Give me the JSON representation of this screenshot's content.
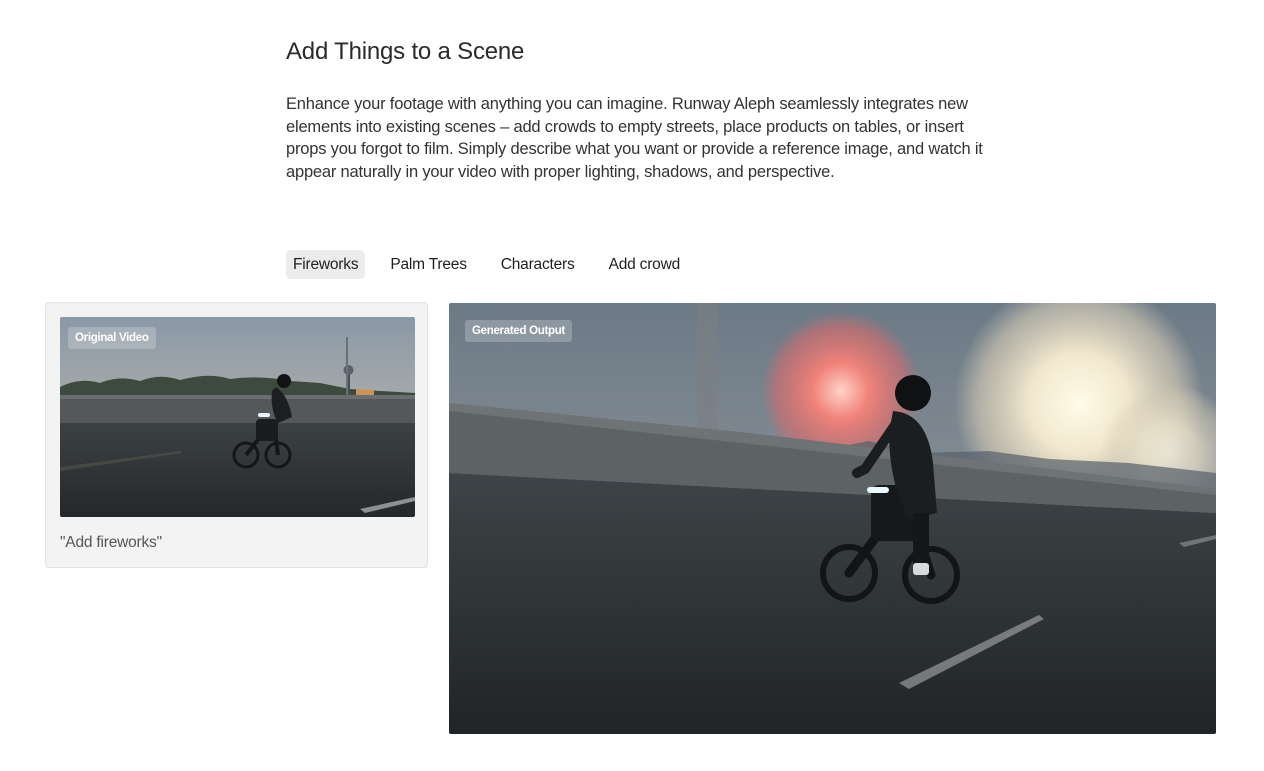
{
  "section": {
    "title": "Add Things to a Scene",
    "description": "Enhance your footage with anything you can imagine. Runway Aleph seamlessly integrates new elements into existing scenes – add crowds to empty streets, place products on tables, or insert props you forgot to film. Simply describe what you want or provide a reference image, and watch it appear naturally in your video with proper lighting, shadows, and perspective."
  },
  "tabs": [
    {
      "label": "Fireworks",
      "active": true
    },
    {
      "label": "Palm Trees",
      "active": false
    },
    {
      "label": "Characters",
      "active": false
    },
    {
      "label": "Add crowd",
      "active": false
    }
  ],
  "original": {
    "badge": "Original Video",
    "prompt": "\"Add fireworks\""
  },
  "output": {
    "badge": "Generated Output"
  },
  "colors": {
    "active_tab_bg": "#ececec",
    "card_bg": "#f3f3f3",
    "text_primary": "#2a2a2a"
  }
}
